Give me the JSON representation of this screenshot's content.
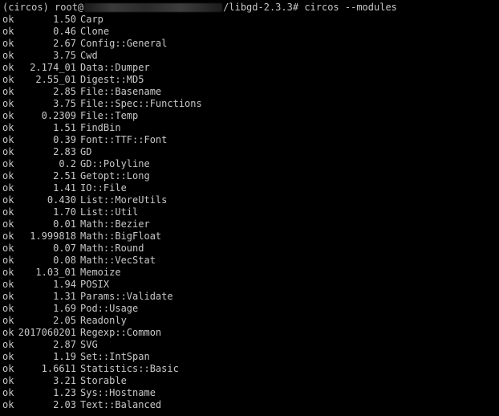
{
  "terminal": {
    "prompt_env": "(circos) root@",
    "prompt_path": "/libgd-2.3.3# ",
    "command": "circos --modules",
    "colors": {
      "background": "#000000",
      "text": "#c8c8c8"
    }
  },
  "modules": [
    {
      "status": "ok",
      "version": "1.50",
      "name": "Carp"
    },
    {
      "status": "ok",
      "version": "0.46",
      "name": "Clone"
    },
    {
      "status": "ok",
      "version": "2.67",
      "name": "Config::General"
    },
    {
      "status": "ok",
      "version": "3.75",
      "name": "Cwd"
    },
    {
      "status": "ok",
      "version": "2.174_01",
      "name": "Data::Dumper"
    },
    {
      "status": "ok",
      "version": "2.55_01",
      "name": "Digest::MD5"
    },
    {
      "status": "ok",
      "version": "2.85",
      "name": "File::Basename"
    },
    {
      "status": "ok",
      "version": "3.75",
      "name": "File::Spec::Functions"
    },
    {
      "status": "ok",
      "version": "0.2309",
      "name": "File::Temp"
    },
    {
      "status": "ok",
      "version": "1.51",
      "name": "FindBin"
    },
    {
      "status": "ok",
      "version": "0.39",
      "name": "Font::TTF::Font"
    },
    {
      "status": "ok",
      "version": "2.83",
      "name": "GD"
    },
    {
      "status": "ok",
      "version": "0.2",
      "name": "GD::Polyline"
    },
    {
      "status": "ok",
      "version": "2.51",
      "name": "Getopt::Long"
    },
    {
      "status": "ok",
      "version": "1.41",
      "name": "IO::File"
    },
    {
      "status": "ok",
      "version": "0.430",
      "name": "List::MoreUtils"
    },
    {
      "status": "ok",
      "version": "1.70",
      "name": "List::Util"
    },
    {
      "status": "ok",
      "version": "0.01",
      "name": "Math::Bezier"
    },
    {
      "status": "ok",
      "version": "1.999818",
      "name": "Math::BigFloat"
    },
    {
      "status": "ok",
      "version": "0.07",
      "name": "Math::Round"
    },
    {
      "status": "ok",
      "version": "0.08",
      "name": "Math::VecStat"
    },
    {
      "status": "ok",
      "version": "1.03_01",
      "name": "Memoize"
    },
    {
      "status": "ok",
      "version": "1.94",
      "name": "POSIX"
    },
    {
      "status": "ok",
      "version": "1.31",
      "name": "Params::Validate"
    },
    {
      "status": "ok",
      "version": "1.69",
      "name": "Pod::Usage"
    },
    {
      "status": "ok",
      "version": "2.05",
      "name": "Readonly"
    },
    {
      "status": "ok",
      "version": "2017060201",
      "name": "Regexp::Common"
    },
    {
      "status": "ok",
      "version": "2.87",
      "name": "SVG"
    },
    {
      "status": "ok",
      "version": "1.19",
      "name": "Set::IntSpan"
    },
    {
      "status": "ok",
      "version": "1.6611",
      "name": "Statistics::Basic"
    },
    {
      "status": "ok",
      "version": "3.21",
      "name": "Storable"
    },
    {
      "status": "ok",
      "version": "1.23",
      "name": "Sys::Hostname"
    },
    {
      "status": "ok",
      "version": "2.03",
      "name": "Text::Balanced"
    }
  ]
}
